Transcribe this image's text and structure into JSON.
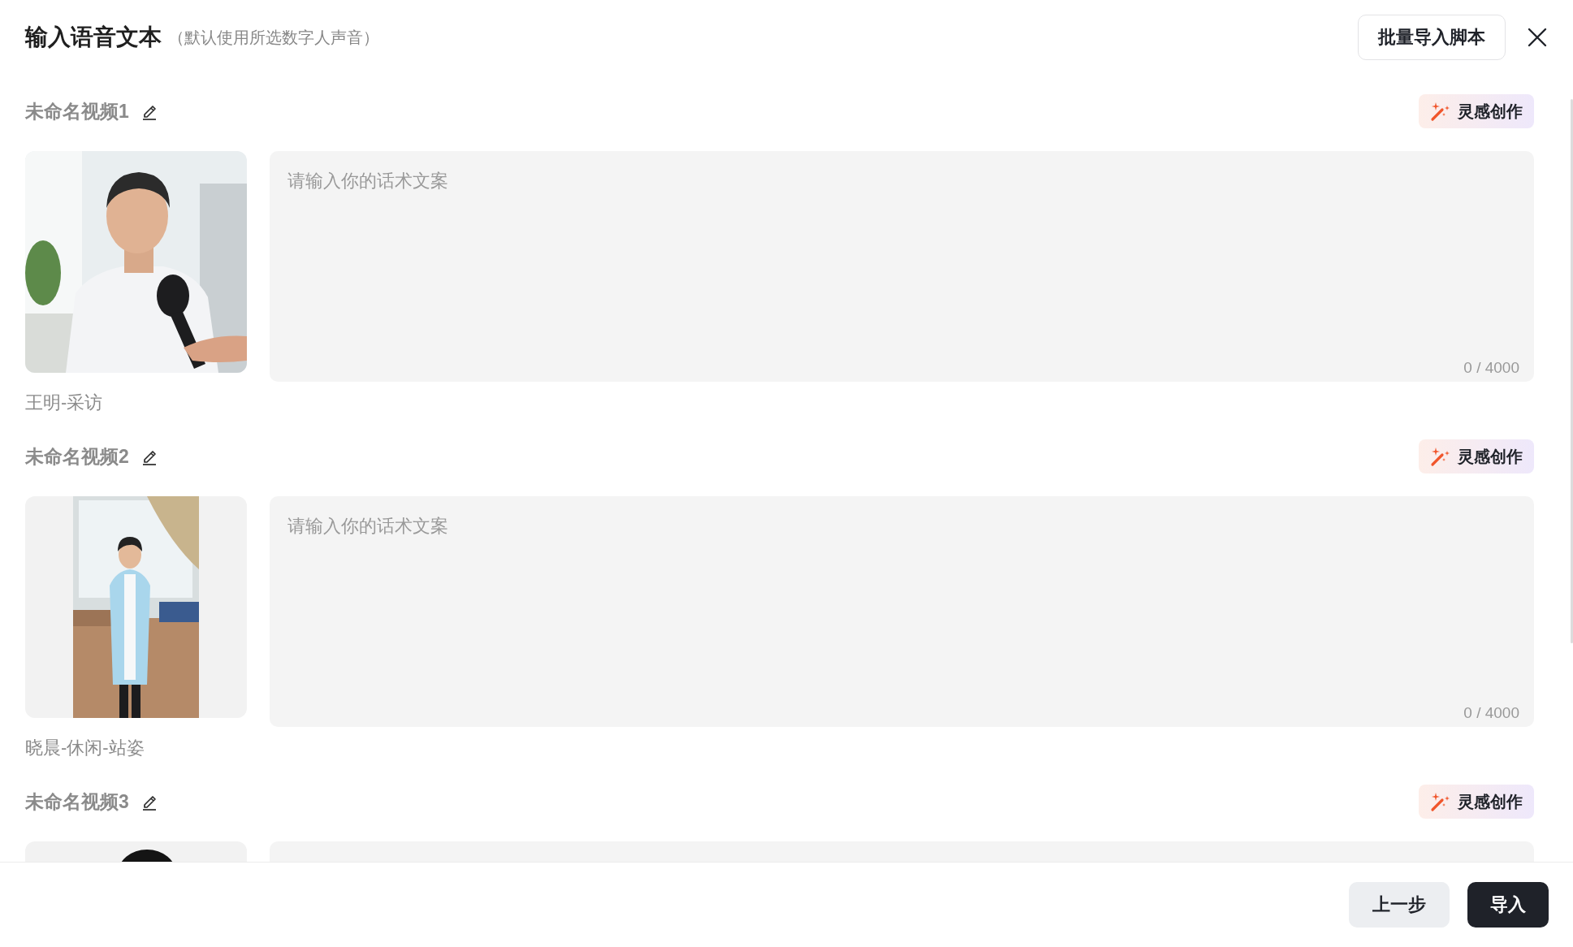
{
  "dialog": {
    "title": "输入语音文本",
    "subtitle": "（默认使用所选数字人声音）",
    "batch_import_button": "批量导入脚本"
  },
  "videos": [
    {
      "title": "未命名视频1",
      "inspiration_button": "灵感创作",
      "script": {
        "placeholder": "请输入你的话术文案",
        "counter": "0 / 4000"
      },
      "avatar_name": "王明-采访"
    },
    {
      "title": "未命名视频2",
      "inspiration_button": "灵感创作",
      "script": {
        "placeholder": "请输入你的话术文案",
        "counter": "0 / 4000"
      },
      "avatar_name": "晓晨-休闲-站姿"
    },
    {
      "title": "未命名视频3",
      "inspiration_button": "灵感创作"
    }
  ],
  "footer": {
    "back_button": "上一步",
    "import_button": "导入"
  }
}
